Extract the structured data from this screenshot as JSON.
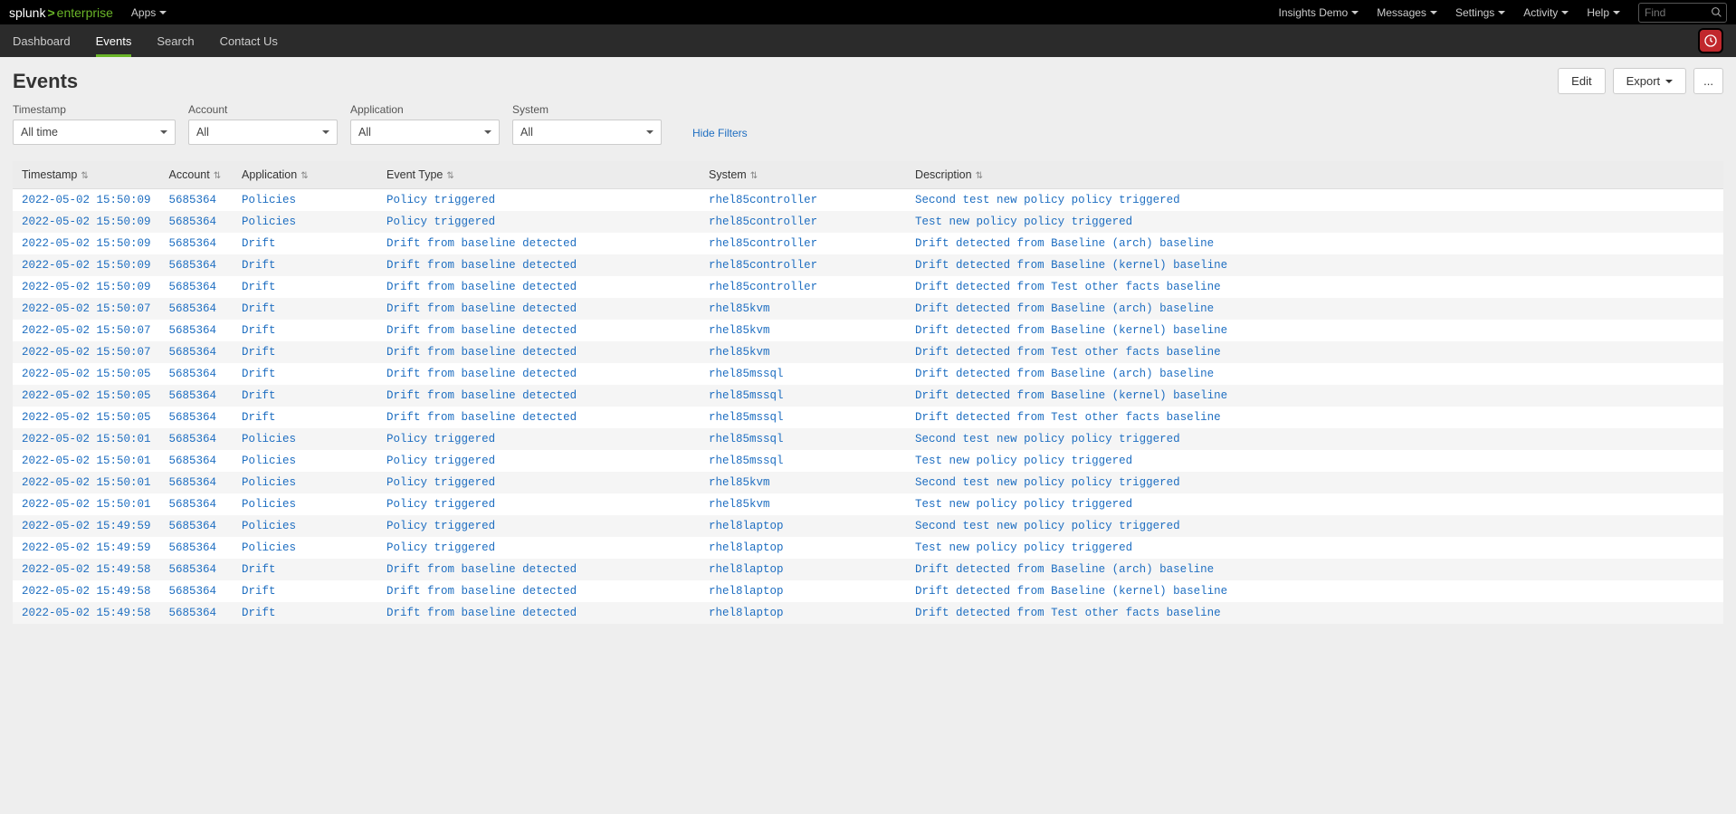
{
  "brand": {
    "part1": "splunk",
    "part2": "enterprise"
  },
  "topmenu": {
    "apps": "Apps"
  },
  "topright": {
    "items": [
      "Insights Demo",
      "Messages",
      "Settings",
      "Activity",
      "Help"
    ],
    "find_placeholder": "Find"
  },
  "nav": {
    "tabs": [
      {
        "label": "Dashboard",
        "active": false
      },
      {
        "label": "Events",
        "active": true
      },
      {
        "label": "Search",
        "active": false
      },
      {
        "label": "Contact Us",
        "active": false
      }
    ]
  },
  "page": {
    "title": "Events",
    "buttons": {
      "edit": "Edit",
      "export": "Export",
      "more": "..."
    }
  },
  "filters": {
    "timestamp": {
      "label": "Timestamp",
      "value": "All time"
    },
    "account": {
      "label": "Account",
      "value": "All"
    },
    "application": {
      "label": "Application",
      "value": "All"
    },
    "system": {
      "label": "System",
      "value": "All"
    },
    "hide": "Hide Filters"
  },
  "columns": [
    "Timestamp",
    "Account",
    "Application",
    "Event Type",
    "System",
    "Description"
  ],
  "rows": [
    {
      "ts": "2022-05-02 15:50:09",
      "acc": "5685364",
      "app": "Policies",
      "evt": "Policy triggered",
      "sys": "rhel85controller",
      "desc": "Second test new policy policy triggered"
    },
    {
      "ts": "2022-05-02 15:50:09",
      "acc": "5685364",
      "app": "Policies",
      "evt": "Policy triggered",
      "sys": "rhel85controller",
      "desc": "Test new policy policy triggered"
    },
    {
      "ts": "2022-05-02 15:50:09",
      "acc": "5685364",
      "app": "Drift",
      "evt": "Drift from baseline detected",
      "sys": "rhel85controller",
      "desc": "Drift detected from Baseline (arch) baseline"
    },
    {
      "ts": "2022-05-02 15:50:09",
      "acc": "5685364",
      "app": "Drift",
      "evt": "Drift from baseline detected",
      "sys": "rhel85controller",
      "desc": "Drift detected from Baseline (kernel) baseline"
    },
    {
      "ts": "2022-05-02 15:50:09",
      "acc": "5685364",
      "app": "Drift",
      "evt": "Drift from baseline detected",
      "sys": "rhel85controller",
      "desc": "Drift detected from Test other facts baseline"
    },
    {
      "ts": "2022-05-02 15:50:07",
      "acc": "5685364",
      "app": "Drift",
      "evt": "Drift from baseline detected",
      "sys": "rhel85kvm",
      "desc": "Drift detected from Baseline (arch) baseline"
    },
    {
      "ts": "2022-05-02 15:50:07",
      "acc": "5685364",
      "app": "Drift",
      "evt": "Drift from baseline detected",
      "sys": "rhel85kvm",
      "desc": "Drift detected from Baseline (kernel) baseline"
    },
    {
      "ts": "2022-05-02 15:50:07",
      "acc": "5685364",
      "app": "Drift",
      "evt": "Drift from baseline detected",
      "sys": "rhel85kvm",
      "desc": "Drift detected from Test other facts baseline"
    },
    {
      "ts": "2022-05-02 15:50:05",
      "acc": "5685364",
      "app": "Drift",
      "evt": "Drift from baseline detected",
      "sys": "rhel85mssql",
      "desc": "Drift detected from Baseline (arch) baseline"
    },
    {
      "ts": "2022-05-02 15:50:05",
      "acc": "5685364",
      "app": "Drift",
      "evt": "Drift from baseline detected",
      "sys": "rhel85mssql",
      "desc": "Drift detected from Baseline (kernel) baseline"
    },
    {
      "ts": "2022-05-02 15:50:05",
      "acc": "5685364",
      "app": "Drift",
      "evt": "Drift from baseline detected",
      "sys": "rhel85mssql",
      "desc": "Drift detected from Test other facts baseline"
    },
    {
      "ts": "2022-05-02 15:50:01",
      "acc": "5685364",
      "app": "Policies",
      "evt": "Policy triggered",
      "sys": "rhel85mssql",
      "desc": "Second test new policy policy triggered"
    },
    {
      "ts": "2022-05-02 15:50:01",
      "acc": "5685364",
      "app": "Policies",
      "evt": "Policy triggered",
      "sys": "rhel85mssql",
      "desc": "Test new policy policy triggered"
    },
    {
      "ts": "2022-05-02 15:50:01",
      "acc": "5685364",
      "app": "Policies",
      "evt": "Policy triggered",
      "sys": "rhel85kvm",
      "desc": "Second test new policy policy triggered"
    },
    {
      "ts": "2022-05-02 15:50:01",
      "acc": "5685364",
      "app": "Policies",
      "evt": "Policy triggered",
      "sys": "rhel85kvm",
      "desc": "Test new policy policy triggered"
    },
    {
      "ts": "2022-05-02 15:49:59",
      "acc": "5685364",
      "app": "Policies",
      "evt": "Policy triggered",
      "sys": "rhel8laptop",
      "desc": "Second test new policy policy triggered"
    },
    {
      "ts": "2022-05-02 15:49:59",
      "acc": "5685364",
      "app": "Policies",
      "evt": "Policy triggered",
      "sys": "rhel8laptop",
      "desc": "Test new policy policy triggered"
    },
    {
      "ts": "2022-05-02 15:49:58",
      "acc": "5685364",
      "app": "Drift",
      "evt": "Drift from baseline detected",
      "sys": "rhel8laptop",
      "desc": "Drift detected from Baseline (arch) baseline"
    },
    {
      "ts": "2022-05-02 15:49:58",
      "acc": "5685364",
      "app": "Drift",
      "evt": "Drift from baseline detected",
      "sys": "rhel8laptop",
      "desc": "Drift detected from Baseline (kernel) baseline"
    },
    {
      "ts": "2022-05-02 15:49:58",
      "acc": "5685364",
      "app": "Drift",
      "evt": "Drift from baseline detected",
      "sys": "rhel8laptop",
      "desc": "Drift detected from Test other facts baseline"
    }
  ]
}
